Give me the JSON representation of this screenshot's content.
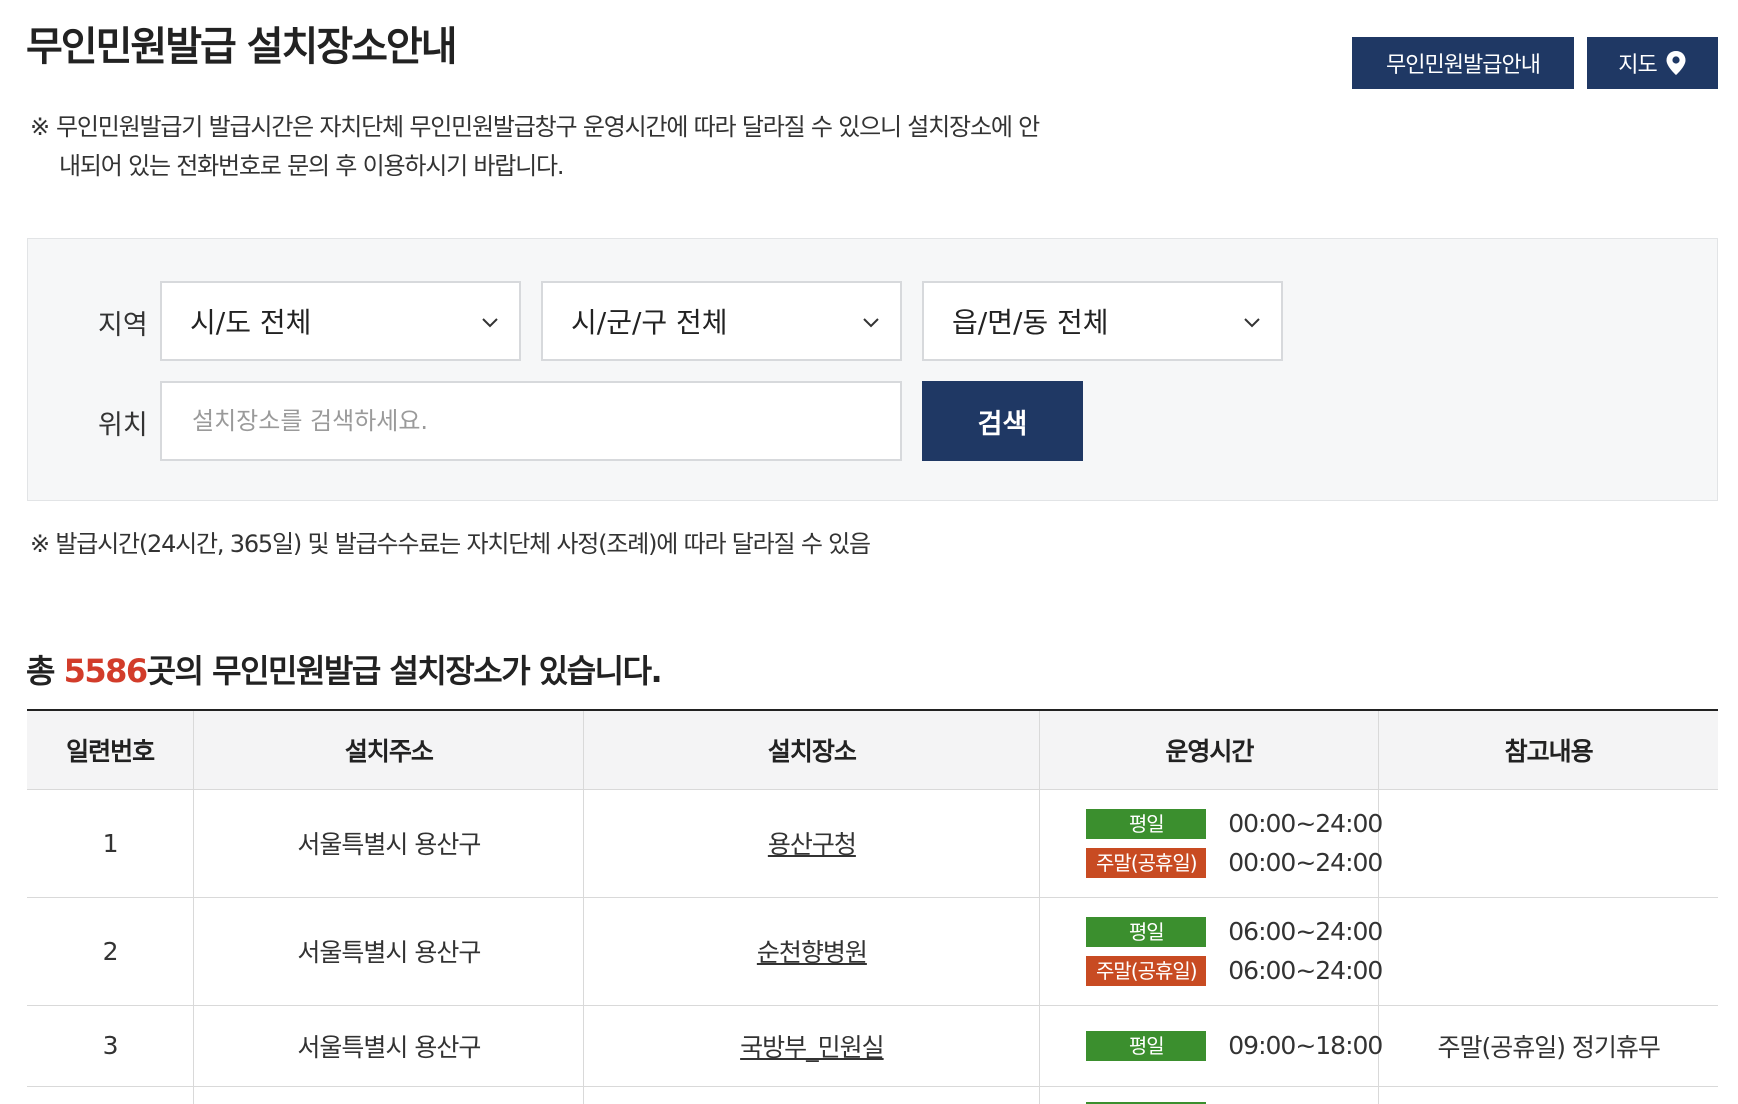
{
  "header": {
    "title": "무인민원발급 설치장소안내",
    "guide_button": "무인민원발급안내",
    "map_button": "지도",
    "map_icon": "map-pin-icon"
  },
  "notice": {
    "mark": "※",
    "line1": "무인민원발급기 발급시간은 자치단체 무인민원발급창구 운영시간에 따라 달라질 수 있으니 설치장소에 안",
    "line2": "내되어 있는 전화번호로 문의 후 이용하시기 바랍니다."
  },
  "search": {
    "region_label": "지역",
    "location_label": "위치",
    "sido": "시/도 전체",
    "sigungu": "시/군/구 전체",
    "eupmyeondong": "읍/면/동 전체",
    "placeholder": "설치장소를 검색하세요.",
    "button": "검색",
    "chevron_icon": "chevron-down-icon"
  },
  "notice2": "※ 발급시간(24시간, 365일) 및 발급수수료는 자치단체 사정(조례)에 따라 달라질 수 있음",
  "summary": {
    "prefix": "총 ",
    "count": "5586",
    "suffix": "곳의 무인민원발급 설치장소가 있습니다."
  },
  "table": {
    "headers": [
      "일련번호",
      "설치주소",
      "설치장소",
      "운영시간",
      "참고내용"
    ],
    "weekday_label": "평일",
    "weekend_label": "주말(공휴일)",
    "rows": [
      {
        "no": "1",
        "address": "서울특별시 용산구",
        "place": "용산구청",
        "weekday": "00:00~24:00",
        "weekend": "00:00~24:00",
        "note": ""
      },
      {
        "no": "2",
        "address": "서울특별시 용산구",
        "place": "순천향병원",
        "weekday": "06:00~24:00",
        "weekend": "06:00~24:00",
        "note": ""
      },
      {
        "no": "3",
        "address": "서울특별시 용산구",
        "place": "국방부_민원실",
        "weekday": "09:00~18:00",
        "weekend": "",
        "note": "주말(공휴일) 정기휴무"
      }
    ]
  },
  "colors": {
    "navy": "#1f3864",
    "weekday_badge": "#3b8f2e",
    "weekend_badge": "#c84b22",
    "count_red": "#d23c2a"
  }
}
